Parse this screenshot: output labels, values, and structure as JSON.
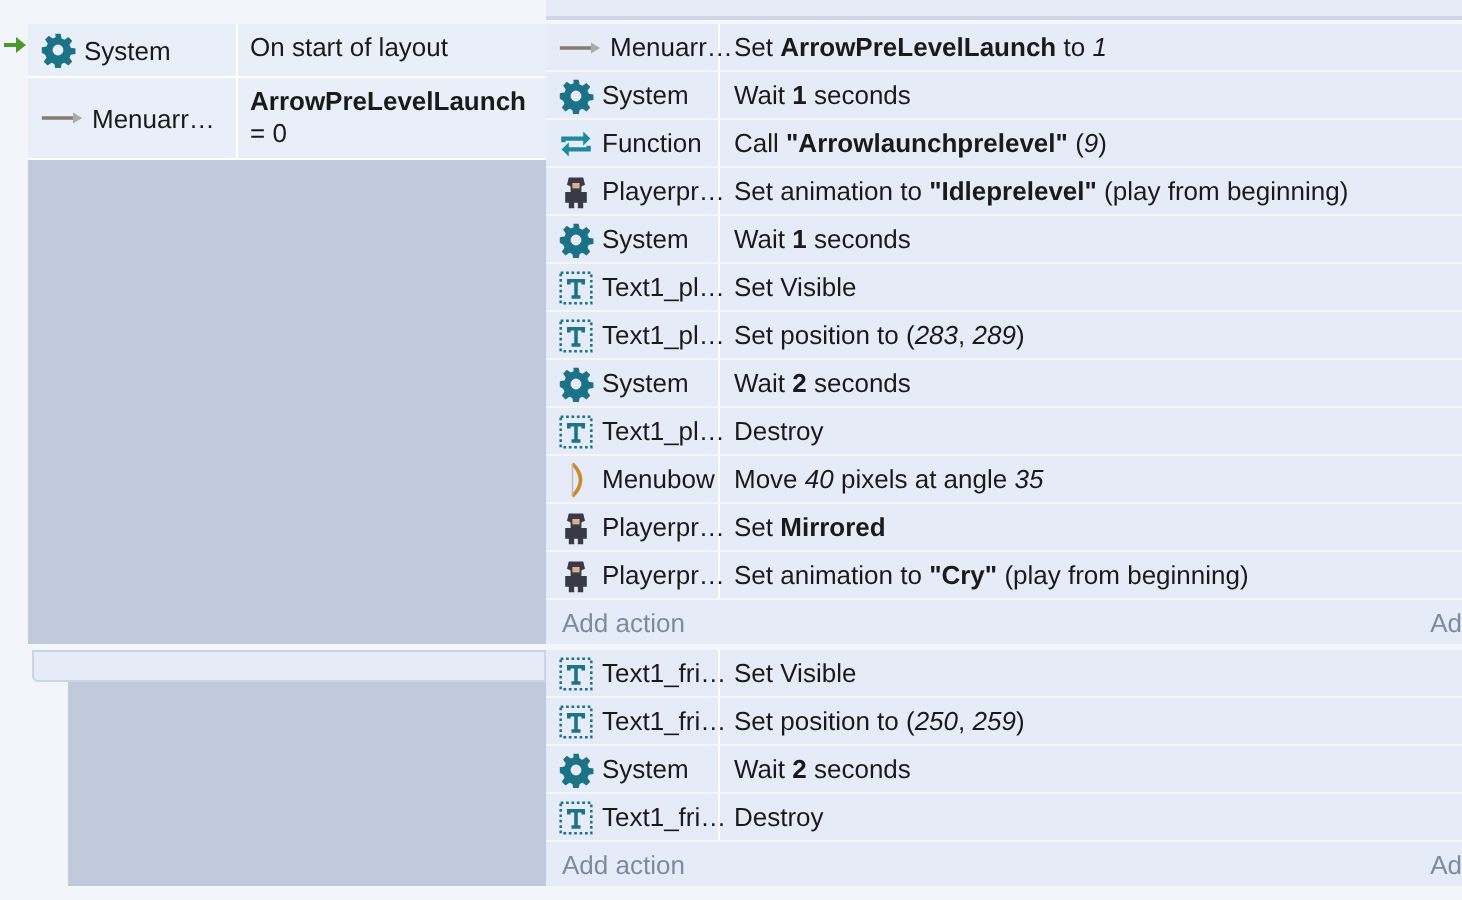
{
  "events": [
    {
      "triggered": true,
      "conditions": [
        {
          "kind": "gear",
          "object": "System",
          "text": "On start of layout"
        },
        {
          "kind": "arrow",
          "object": "Menuarr…",
          "text": "**ArrowPreLevelLaunch** = 0"
        }
      ],
      "actions": [
        {
          "kind": "arrow",
          "object": "Menuarr…",
          "text": "Set **ArrowPreLevelLaunch** to *1*"
        },
        {
          "kind": "gear",
          "object": "System",
          "text": "Wait **1** seconds"
        },
        {
          "kind": "loop",
          "object": "Function",
          "text": "Call **\"Arrowlaunchprelevel\"** (*9*)"
        },
        {
          "kind": "character",
          "object": "Playerpr…",
          "text": "Set animation to **\"Idleprelevel\"** (play from beginning)"
        },
        {
          "kind": "gear",
          "object": "System",
          "text": "Wait **1** seconds"
        },
        {
          "kind": "text",
          "object": "Text1_pl…",
          "text": "Set Visible"
        },
        {
          "kind": "text",
          "object": "Text1_pl…",
          "text": "Set position to (*283*, *289*)"
        },
        {
          "kind": "gear",
          "object": "System",
          "text": "Wait **2** seconds"
        },
        {
          "kind": "text",
          "object": "Text1_pl…",
          "text": "Destroy"
        },
        {
          "kind": "bow",
          "object": "Menubow",
          "text": "Move *40* pixels at angle *35*"
        },
        {
          "kind": "character",
          "object": "Playerpr…",
          "text": "Set **Mirrored**"
        },
        {
          "kind": "character",
          "object": "Playerpr…",
          "text": "Set animation to **\"Cry\"** (play from beginning)"
        }
      ],
      "add_action": "Add action",
      "add_action_right": "Ad"
    },
    {
      "triggered": false,
      "actions": [
        {
          "kind": "text",
          "object": "Text1_fri…",
          "text": "Set Visible"
        },
        {
          "kind": "text",
          "object": "Text1_fri…",
          "text": "Set position to (*250*, *259*)"
        },
        {
          "kind": "gear",
          "object": "System",
          "text": "Wait **2** seconds"
        },
        {
          "kind": "text",
          "object": "Text1_fri…",
          "text": "Destroy"
        }
      ],
      "add_action": "Add action",
      "add_action_right": "Ad"
    }
  ]
}
